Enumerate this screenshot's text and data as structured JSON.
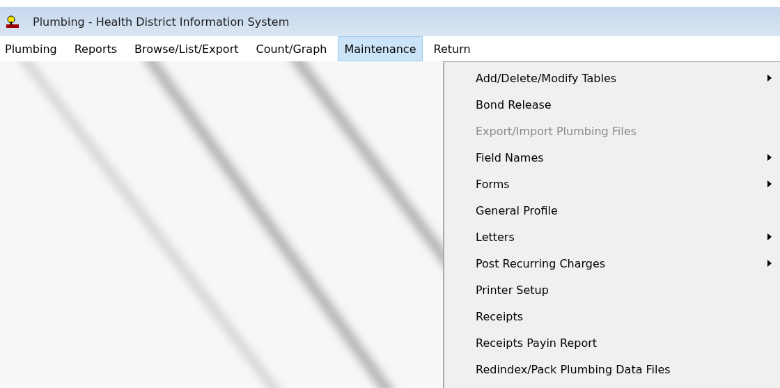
{
  "window": {
    "title": "Plumbing - Health District Information System"
  },
  "menu_bar": [
    {
      "label": "Plumbing",
      "selected": false
    },
    {
      "label": "Reports",
      "selected": false
    },
    {
      "label": "Browse/List/Export",
      "selected": false
    },
    {
      "label": "Count/Graph",
      "selected": false
    },
    {
      "label": "Maintenance",
      "selected": true
    },
    {
      "label": "Return",
      "selected": false
    }
  ],
  "dropdown": {
    "items": [
      {
        "label": "Add/Delete/Modify Tables",
        "disabled": false,
        "submenu": true
      },
      {
        "label": "Bond Release",
        "disabled": false,
        "submenu": false
      },
      {
        "label": "Export/Import Plumbing Files",
        "disabled": true,
        "submenu": false
      },
      {
        "label": "Field Names",
        "disabled": false,
        "submenu": true
      },
      {
        "label": "Forms",
        "disabled": false,
        "submenu": true
      },
      {
        "label": "General Profile",
        "disabled": false,
        "submenu": false
      },
      {
        "label": "Letters",
        "disabled": false,
        "submenu": true
      },
      {
        "label": "Post Recurring Charges",
        "disabled": false,
        "submenu": true
      },
      {
        "label": "Printer Setup",
        "disabled": false,
        "submenu": false
      },
      {
        "label": "Receipts",
        "disabled": false,
        "submenu": false
      },
      {
        "label": "Receipts Payin Report",
        "disabled": false,
        "submenu": false
      },
      {
        "label": "Redindex/Pack Plumbing Data Files",
        "disabled": false,
        "submenu": false
      }
    ]
  }
}
